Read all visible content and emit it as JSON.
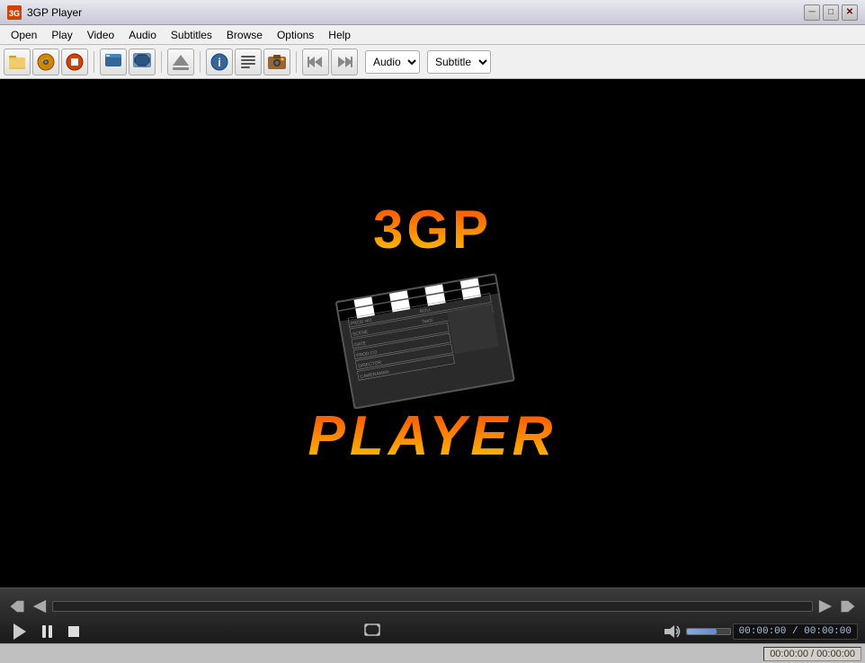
{
  "window": {
    "title": "3GP Player",
    "icon": "3GP"
  },
  "titlebar": {
    "minimize_label": "─",
    "restore_label": "□",
    "close_label": "✕"
  },
  "menu": {
    "items": [
      {
        "label": "Open"
      },
      {
        "label": "Play"
      },
      {
        "label": "Video"
      },
      {
        "label": "Audio"
      },
      {
        "label": "Subtitles"
      },
      {
        "label": "Browse"
      },
      {
        "label": "Options"
      },
      {
        "label": "Help"
      }
    ]
  },
  "toolbar": {
    "buttons": [
      {
        "name": "open-file",
        "icon": "📁"
      },
      {
        "name": "open-disc",
        "icon": "💿"
      },
      {
        "name": "stop",
        "icon": "⏹"
      },
      {
        "name": "window-mode",
        "icon": "▣"
      },
      {
        "name": "fullscreen",
        "icon": "⛶"
      },
      {
        "name": "eject",
        "icon": "⏏"
      },
      {
        "name": "info",
        "icon": "ℹ"
      },
      {
        "name": "playlist",
        "icon": "≡"
      },
      {
        "name": "capture",
        "icon": "📷"
      },
      {
        "name": "prev",
        "icon": "⏮"
      },
      {
        "name": "next",
        "icon": "⏭"
      }
    ],
    "audio_dropdown": {
      "label": "Audio",
      "options": [
        "Audio"
      ]
    },
    "subtitle_dropdown": {
      "label": "Subtitle",
      "options": [
        "Subtitle"
      ]
    }
  },
  "logo": {
    "top_text": "3GP",
    "bottom_text": "PLAYER"
  },
  "controls": {
    "play_label": "Play",
    "pause_label": "Pause",
    "stop_label": "Stop",
    "prev_label": "Previous",
    "next_label": "Next",
    "fullscreen_label": "Fullscreen",
    "volume_label": "Volume",
    "time_current": "00:00:00",
    "time_total": "00:00:00",
    "time_display": "00:00:00 / 00:00:00"
  },
  "statusbar": {
    "time_info": "00:00:00 / 00:00:00"
  }
}
